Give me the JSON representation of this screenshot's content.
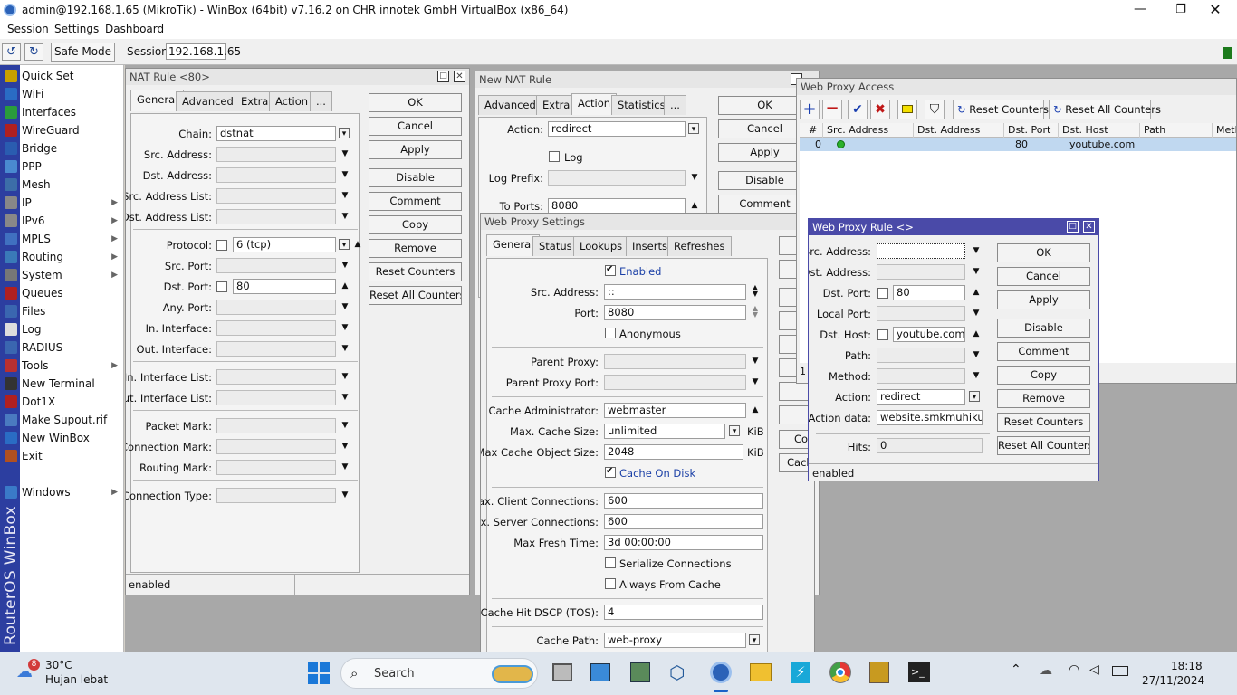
{
  "titlebar": {
    "title": "admin@192.168.1.65 (MikroTik) - WinBox (64bit) v7.16.2 on CHR innotek GmbH VirtualBox (x86_64)"
  },
  "menubar": [
    "Session",
    "Settings",
    "Dashboard"
  ],
  "toolbar": {
    "safe_mode": "Safe Mode",
    "session_label": "Session:",
    "session_value": "192.168.1.65"
  },
  "sidebar": {
    "brand": "RouterOS WinBox",
    "items": [
      {
        "label": "Quick Set",
        "icon": "quickset-icon",
        "color": "#c8a000",
        "arrow": false
      },
      {
        "label": "WiFi",
        "icon": "wifi-icon",
        "color": "#2a6cc4",
        "arrow": false
      },
      {
        "label": "Interfaces",
        "icon": "interfaces-icon",
        "color": "#2a9c3c",
        "arrow": false
      },
      {
        "label": "WireGuard",
        "icon": "wireguard-icon",
        "color": "#b02020",
        "arrow": false
      },
      {
        "label": "Bridge",
        "icon": "bridge-icon",
        "color": "#2a5cb0",
        "arrow": false
      },
      {
        "label": "PPP",
        "icon": "ppp-icon",
        "color": "#4a8ad0",
        "arrow": false
      },
      {
        "label": "Mesh",
        "icon": "mesh-icon",
        "color": "#3c6ea8",
        "arrow": false
      },
      {
        "label": "IP",
        "icon": "ip-icon",
        "color": "#888888",
        "arrow": true
      },
      {
        "label": "IPv6",
        "icon": "ipv6-icon",
        "color": "#888888",
        "arrow": true
      },
      {
        "label": "MPLS",
        "icon": "mpls-icon",
        "color": "#4070c0",
        "arrow": true
      },
      {
        "label": "Routing",
        "icon": "routing-icon",
        "color": "#3a7ab8",
        "arrow": true
      },
      {
        "label": "System",
        "icon": "system-icon",
        "color": "#777777",
        "arrow": true
      },
      {
        "label": "Queues",
        "icon": "queues-icon",
        "color": "#b02020",
        "arrow": false
      },
      {
        "label": "Files",
        "icon": "files-icon",
        "color": "#3a66b0",
        "arrow": false
      },
      {
        "label": "Log",
        "icon": "log-icon",
        "color": "#dddddd",
        "arrow": false
      },
      {
        "label": "RADIUS",
        "icon": "radius-icon",
        "color": "#3a66b0",
        "arrow": false
      },
      {
        "label": "Tools",
        "icon": "tools-icon",
        "color": "#b83030",
        "arrow": true
      },
      {
        "label": "New Terminal",
        "icon": "terminal-icon",
        "color": "#333333",
        "arrow": false
      },
      {
        "label": "Dot1X",
        "icon": "dot1x-icon",
        "color": "#b02020",
        "arrow": false
      },
      {
        "label": "Make Supout.rif",
        "icon": "supout-icon",
        "color": "#4a7ac0",
        "arrow": false
      },
      {
        "label": "New WinBox",
        "icon": "winbox-icon",
        "color": "#2a6cc4",
        "arrow": false
      },
      {
        "label": "Exit",
        "icon": "exit-icon",
        "color": "#b05020",
        "arrow": false
      },
      {
        "label": "Windows",
        "icon": "windows-icon",
        "color": "#3a7ac8",
        "arrow": true
      }
    ]
  },
  "nat": {
    "title": "NAT Rule <80>",
    "tabs": [
      "General",
      "Advanced",
      "Extra",
      "Action",
      "..."
    ],
    "fields": [
      {
        "label": "Chain:",
        "value": "dstnat"
      },
      {
        "label": "Src. Address:",
        "value": ""
      },
      {
        "label": "Dst. Address:",
        "value": ""
      },
      {
        "label": "Src. Address List:",
        "value": ""
      },
      {
        "label": "Dst. Address List:",
        "value": ""
      },
      {
        "label": "Protocol:",
        "value": "6 (tcp)"
      },
      {
        "label": "Src. Port:",
        "value": ""
      },
      {
        "label": "Dst. Port:",
        "value": "80"
      },
      {
        "label": "Any. Port:",
        "value": ""
      },
      {
        "label": "In. Interface:",
        "value": ""
      },
      {
        "label": "Out. Interface:",
        "value": ""
      },
      {
        "label": "In. Interface List:",
        "value": ""
      },
      {
        "label": "Out. Interface List:",
        "value": ""
      },
      {
        "label": "Packet Mark:",
        "value": ""
      },
      {
        "label": "Connection Mark:",
        "value": ""
      },
      {
        "label": "Routing Mark:",
        "value": ""
      },
      {
        "label": "Connection Type:",
        "value": ""
      }
    ],
    "buttons": [
      "OK",
      "Cancel",
      "Apply",
      "Disable",
      "Comment",
      "Copy",
      "Remove",
      "Reset Counters",
      "Reset All Counters"
    ],
    "status": "enabled"
  },
  "newnat": {
    "title": "New NAT Rule",
    "tabs": [
      "Advanced",
      "Extra",
      "Action",
      "Statistics",
      "..."
    ],
    "action_label": "Action:",
    "action_value": "redirect",
    "log_label": "Log",
    "log_prefix_label": "Log Prefix:",
    "to_ports_label": "To Ports:",
    "to_ports_value": "8080",
    "buttons": [
      "OK",
      "Cancel",
      "Apply",
      "Disable",
      "Comment"
    ]
  },
  "proxy": {
    "title": "Web Proxy Settings",
    "tabs": [
      "General",
      "Status",
      "Lookups",
      "Inserts",
      "Refreshes"
    ],
    "enabled": "Enabled",
    "src_label": "Src. Address:",
    "src_value": "::",
    "port_label": "Port:",
    "port_value": "8080",
    "anon": "Anonymous",
    "parent_proxy": "Parent Proxy:",
    "parent_proxy_port": "Parent Proxy Port:",
    "cache_admin_label": "Cache Administrator:",
    "cache_admin": "webmaster",
    "max_cache_label": "Max. Cache Size:",
    "max_cache": "unlimited",
    "kib": "KiB",
    "max_obj_label": "Max Cache Object Size:",
    "max_obj": "2048",
    "cache_on_disk": "Cache On Disk",
    "max_client_label": "Max. Client Connections:",
    "max_client": "600",
    "max_server_label": "Max. Server Connections:",
    "max_server": "600",
    "fresh_label": "Max Fresh Time:",
    "fresh": "3d 00:00:00",
    "serialize": "Serialize Connections",
    "always": "Always From Cache",
    "dscp_label": "Cache Hit DSCP (TOS):",
    "dscp": "4",
    "path_label": "Cache Path:",
    "path": "web-proxy",
    "side_buttons": [
      "Co",
      "Cach"
    ]
  },
  "access": {
    "title": "Web Proxy Access",
    "reset": "Reset Counters",
    "reset_all": "Reset All Counters",
    "columns": [
      "#",
      "Src. Address",
      "Dst. Address",
      "Dst. Port",
      "Dst. Host",
      "Path",
      "Meth"
    ],
    "row": {
      "num": "0",
      "dst_port": "80",
      "dst_host": "youtube.com"
    },
    "footer": "1"
  },
  "rule": {
    "title": "Web Proxy Rule <>",
    "fields": [
      {
        "label": "Src. Address:",
        "value": ""
      },
      {
        "label": "Dst. Address:",
        "value": ""
      },
      {
        "label": "Dst. Port:",
        "value": "80"
      },
      {
        "label": "Local Port:",
        "value": ""
      },
      {
        "label": "Dst. Host:",
        "value": "youtube.com"
      },
      {
        "label": "Path:",
        "value": ""
      },
      {
        "label": "Method:",
        "value": ""
      },
      {
        "label": "Action:",
        "value": "redirect"
      },
      {
        "label": "Action data:",
        "value": "website.smkmuhikudus."
      }
    ],
    "hits_label": "Hits:",
    "hits": "0",
    "buttons": [
      "OK",
      "Cancel",
      "Apply",
      "Disable",
      "Comment",
      "Copy",
      "Remove",
      "Reset Counters",
      "Reset All Counters"
    ],
    "status": "enabled"
  },
  "taskbar": {
    "weather_temp": "30°C",
    "weather_desc": "Hujan lebat",
    "weather_badge": "8",
    "search": "Search",
    "time": "18:18",
    "date": "27/11/2024"
  }
}
